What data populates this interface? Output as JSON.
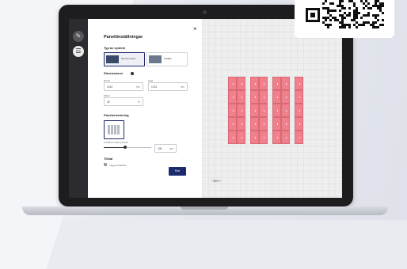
{
  "panel": {
    "title": "Paneltinställningar",
    "close": "×",
    "system_type_label": "Typ av system",
    "systems": [
      {
        "label": "Tak med system"
      },
      {
        "label": "Inställda"
      }
    ],
    "dimensions_label": "Dimensioner",
    "width_label": "Bredd",
    "width_value": "1134",
    "width_unit": "mm",
    "height_label": "Höjd",
    "height_value": "1722",
    "height_unit": "mm",
    "effect_label": "Effekt",
    "effect_value": "30",
    "effect_unit": "W",
    "orientation_label": "Panelorientering",
    "distance_label": "Avstånd mellan paneler",
    "slider_value": 0.45,
    "distance_value": "100",
    "distance_unit": "mm",
    "extras_label": "Tillval",
    "extras_option": "Lägg till takfäste",
    "save_label": "Klar"
  },
  "toolbar": {
    "items": [
      {
        "icon": "pencil-icon"
      },
      {
        "icon": "settings-icon"
      }
    ]
  },
  "canvas": {
    "zoom_label": "− 50% +",
    "panel_color": "#f0808c",
    "groups": [
      {
        "cols": 2,
        "rows": 5
      },
      {
        "cols": 2,
        "rows": 5
      },
      {
        "cols": 2,
        "rows": 5
      },
      {
        "cols": 1,
        "rows": 5
      }
    ]
  },
  "accent": "#1c2a6e"
}
